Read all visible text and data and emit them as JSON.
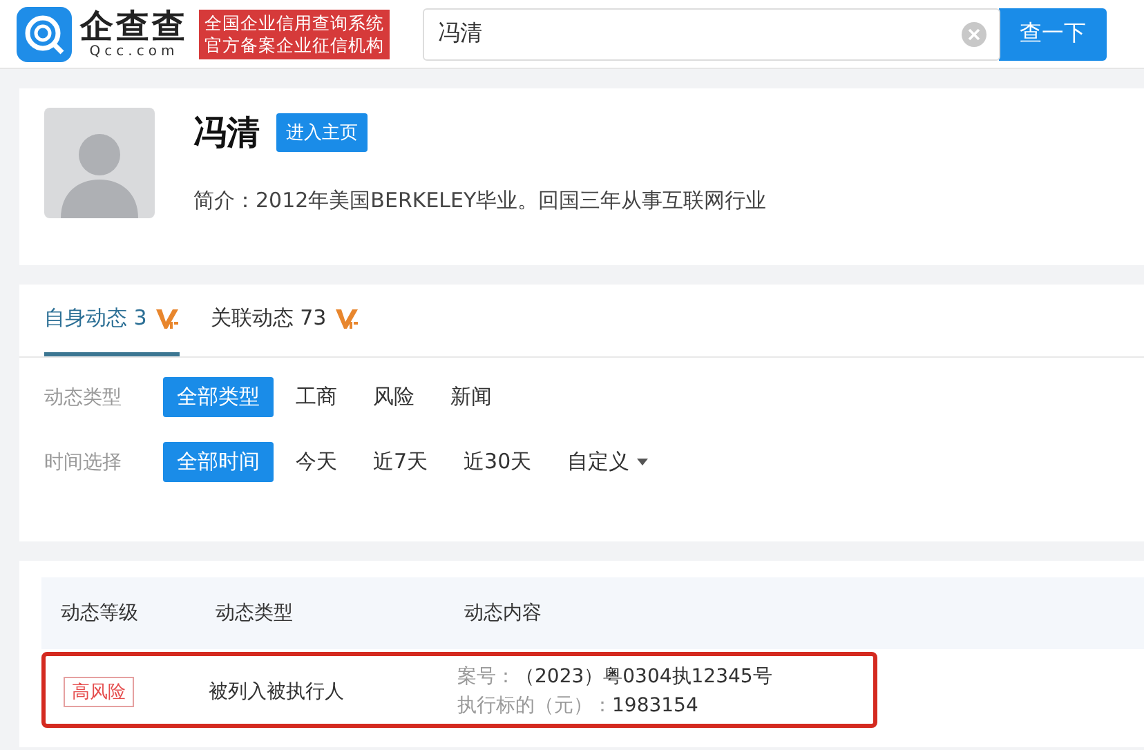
{
  "header": {
    "logo_text": "企查查",
    "logo_domain": "Qcc.com",
    "slogan_lines": [
      "全国企业信用查询系统",
      "官方备案企业征信机构"
    ],
    "search": {
      "value": "冯清"
    },
    "search_button": "查一下"
  },
  "profile": {
    "name": "冯清",
    "homepage_button": "进入主页",
    "intro": "简介：2012年美国BERKELEY毕业。回国三年从事互联网行业"
  },
  "tabs": [
    {
      "label": "自身动态 3",
      "vip": true,
      "selected": true
    },
    {
      "label": "关联动态 73",
      "vip": true,
      "selected": false
    }
  ],
  "filters": [
    {
      "label": "动态类型",
      "options": [
        {
          "label": "全部类型",
          "selected": true,
          "dropdown": false
        },
        {
          "label": "工商",
          "selected": false,
          "dropdown": false
        },
        {
          "label": "风险",
          "selected": false,
          "dropdown": false
        },
        {
          "label": "新闻",
          "selected": false,
          "dropdown": false
        }
      ]
    },
    {
      "label": "时间选择",
      "options": [
        {
          "label": "全部时间",
          "selected": true,
          "dropdown": false
        },
        {
          "label": "今天",
          "selected": false,
          "dropdown": false
        },
        {
          "label": "近7天",
          "selected": false,
          "dropdown": false
        },
        {
          "label": "近30天",
          "selected": false,
          "dropdown": false
        },
        {
          "label": "自定义",
          "selected": false,
          "dropdown": true
        }
      ]
    }
  ],
  "table": {
    "columns": [
      "动态等级",
      "动态类型",
      "动态内容"
    ],
    "rows": [
      {
        "level": "高风险",
        "type": "被列入被执行人",
        "content": [
          {
            "key": "案号：",
            "value": "（2023）粤0304执12345号"
          },
          {
            "key": "执行标的（元）：",
            "value": "1983154"
          }
        ],
        "highlighted": true
      }
    ]
  }
}
